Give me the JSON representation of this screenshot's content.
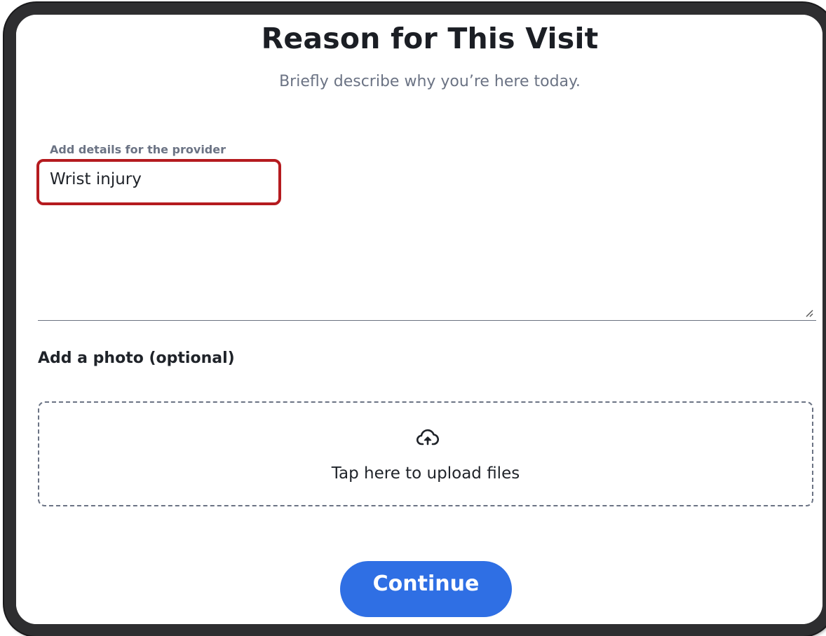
{
  "header": {
    "title": "Reason for This Visit",
    "subtitle": "Briefly describe why you’re here today."
  },
  "details_field": {
    "label": "Add details for the provider",
    "value": "Wrist injury"
  },
  "photo_section": {
    "label": "Add a photo (optional)",
    "upload_text": "Tap here to upload files",
    "upload_icon": "cloud-upload-icon"
  },
  "actions": {
    "continue_label": "Continue"
  },
  "colors": {
    "primary_button": "#2f6fe4",
    "highlight_border": "#b51b1f",
    "muted_text": "#6b7384",
    "frame": "#2e2e30"
  }
}
